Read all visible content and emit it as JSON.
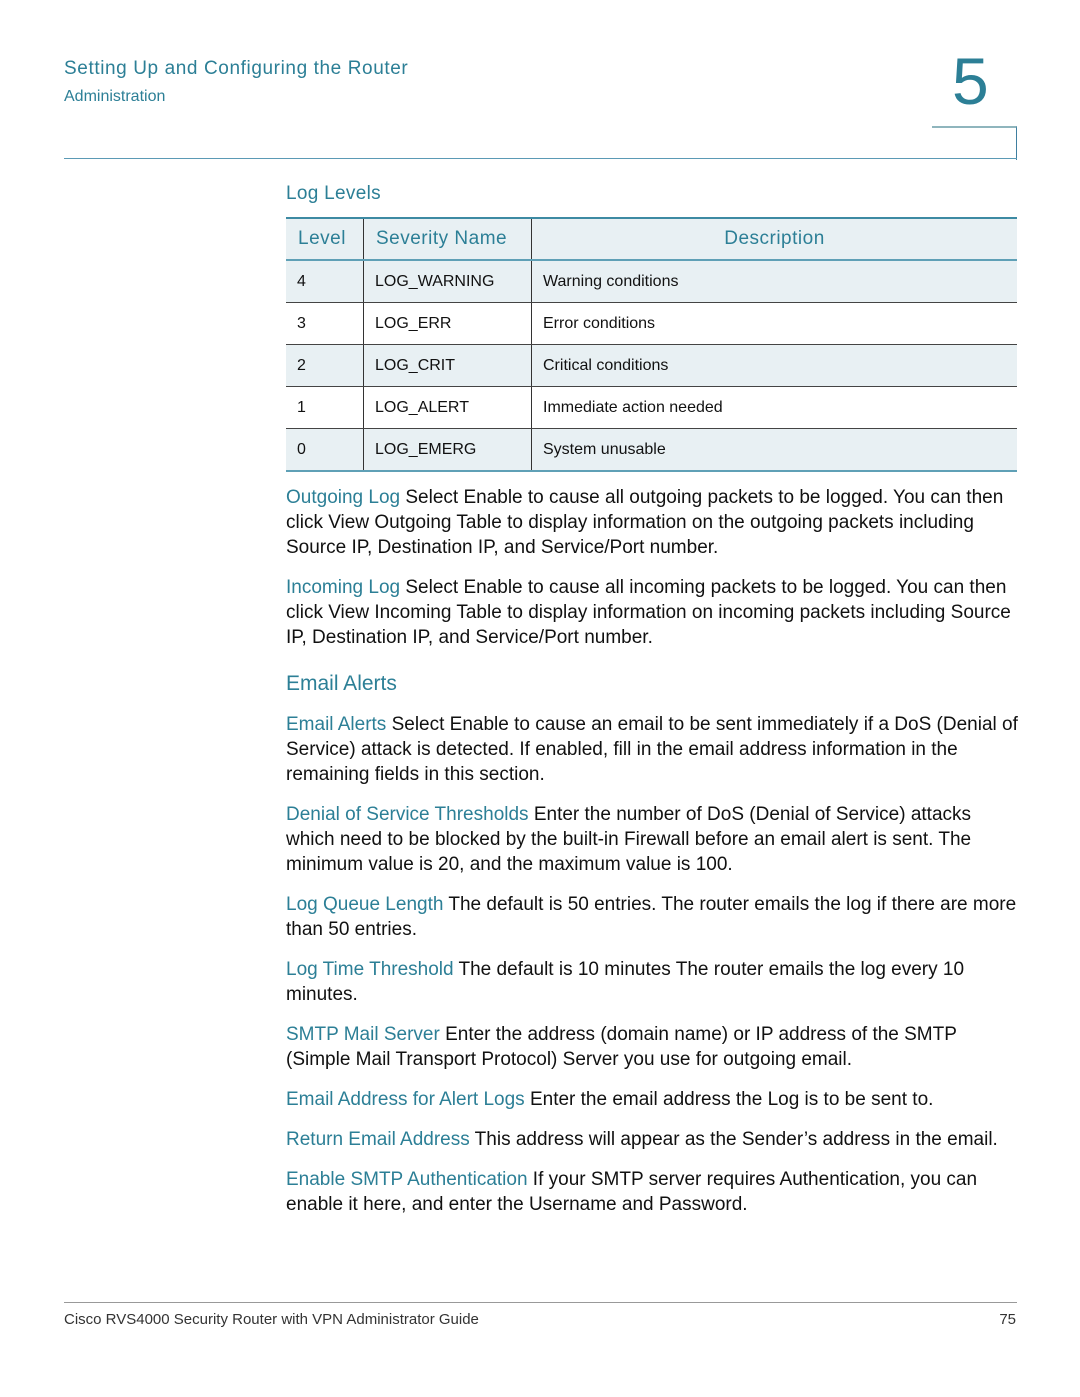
{
  "header": {
    "title": "Setting Up and Configuring the Router",
    "subtitle": "Administration",
    "chapter_number": "5"
  },
  "log_levels": {
    "title": "Log Levels",
    "columns": [
      "Level",
      "Severity Name",
      "Description"
    ],
    "rows": [
      {
        "level": "4",
        "name": "LOG_WARNING",
        "description": "Warning conditions"
      },
      {
        "level": "3",
        "name": "LOG_ERR",
        "description": "Error conditions"
      },
      {
        "level": "2",
        "name": "LOG_CRIT",
        "description": "Critical conditions"
      },
      {
        "level": "1",
        "name": "LOG_ALERT",
        "description": "Immediate action needed"
      },
      {
        "level": "0",
        "name": "LOG_EMERG",
        "description": "System unusable"
      }
    ]
  },
  "paragraphs_logs": [
    {
      "label": "Outgoing Log",
      "text": " Select Enable to cause all outgoing packets to be logged. You can then click View Outgoing Table to display information on the outgoing packets including Source IP, Destination IP, and Service/Port number."
    },
    {
      "label": "Incoming Log",
      "text": " Select Enable to cause all incoming packets to be logged. You can then click View Incoming Table to display information on incoming packets including Source IP, Destination IP, and Service/Port number."
    }
  ],
  "email_section": {
    "heading": "Email Alerts",
    "paragraphs": [
      {
        "label": "Email Alerts",
        "text": " Select Enable to cause an email to be sent immediately if a DoS (Denial of Service) attack is detected. If enabled, fill in the email address information in the remaining fields in this section."
      },
      {
        "label": "Denial of Service Thresholds",
        "text": " Enter the number of DoS (Denial of Service) attacks which need to be blocked by the built-in Firewall before an email alert is sent. The minimum value is 20, and the maximum value is 100."
      },
      {
        "label": "Log Queue Length",
        "text": " The default is 50 entries. The router emails the log if there are more than 50 entries."
      },
      {
        "label": "Log Time Threshold",
        "text": " The default is 10 minutes The router emails the log every 10 minutes."
      },
      {
        "label": "SMTP Mail Server",
        "text": " Enter the address (domain name) or IP address of the SMTP (Simple Mail Transport Protocol) Server you use for outgoing email."
      },
      {
        "label": "Email Address for Alert Logs",
        "text": " Enter the email address the Log is to be sent to."
      },
      {
        "label": "Return Email Address",
        "text": " This address will appear as the Sender’s address in the email."
      },
      {
        "label": "Enable SMTP Authentication",
        "text": " If your SMTP server requires Authentication, you can enable it here, and enter the Username and Password."
      }
    ]
  },
  "footer": {
    "guide_title": "Cisco RVS4000 Security Router with VPN Administrator Guide",
    "page_number": "75"
  }
}
